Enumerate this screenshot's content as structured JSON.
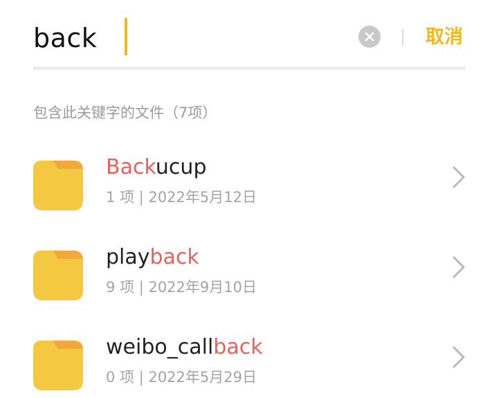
{
  "search": {
    "query": "back",
    "cancel_label": "取消"
  },
  "results": {
    "header": "包含此关键字的文件（7项）",
    "items": [
      {
        "name_before": "",
        "name_match": "Back",
        "name_after": "ucup",
        "meta": "1 项 | 2022年5月12日"
      },
      {
        "name_before": "play",
        "name_match": "back",
        "name_after": "",
        "meta": "9 项 | 2022年9月10日"
      },
      {
        "name_before": "weibo_call",
        "name_match": "back",
        "name_after": "",
        "meta": "0 项 | 2022年5月29日"
      }
    ]
  },
  "colors": {
    "accent": "#f0b81c",
    "highlight": "#e5635c",
    "folder": "#f5c842",
    "folder_tab": "#f0a93a"
  },
  "icons": {
    "clear": "clear-icon",
    "folder": "folder-icon",
    "chevron": "chevron-right-icon"
  }
}
